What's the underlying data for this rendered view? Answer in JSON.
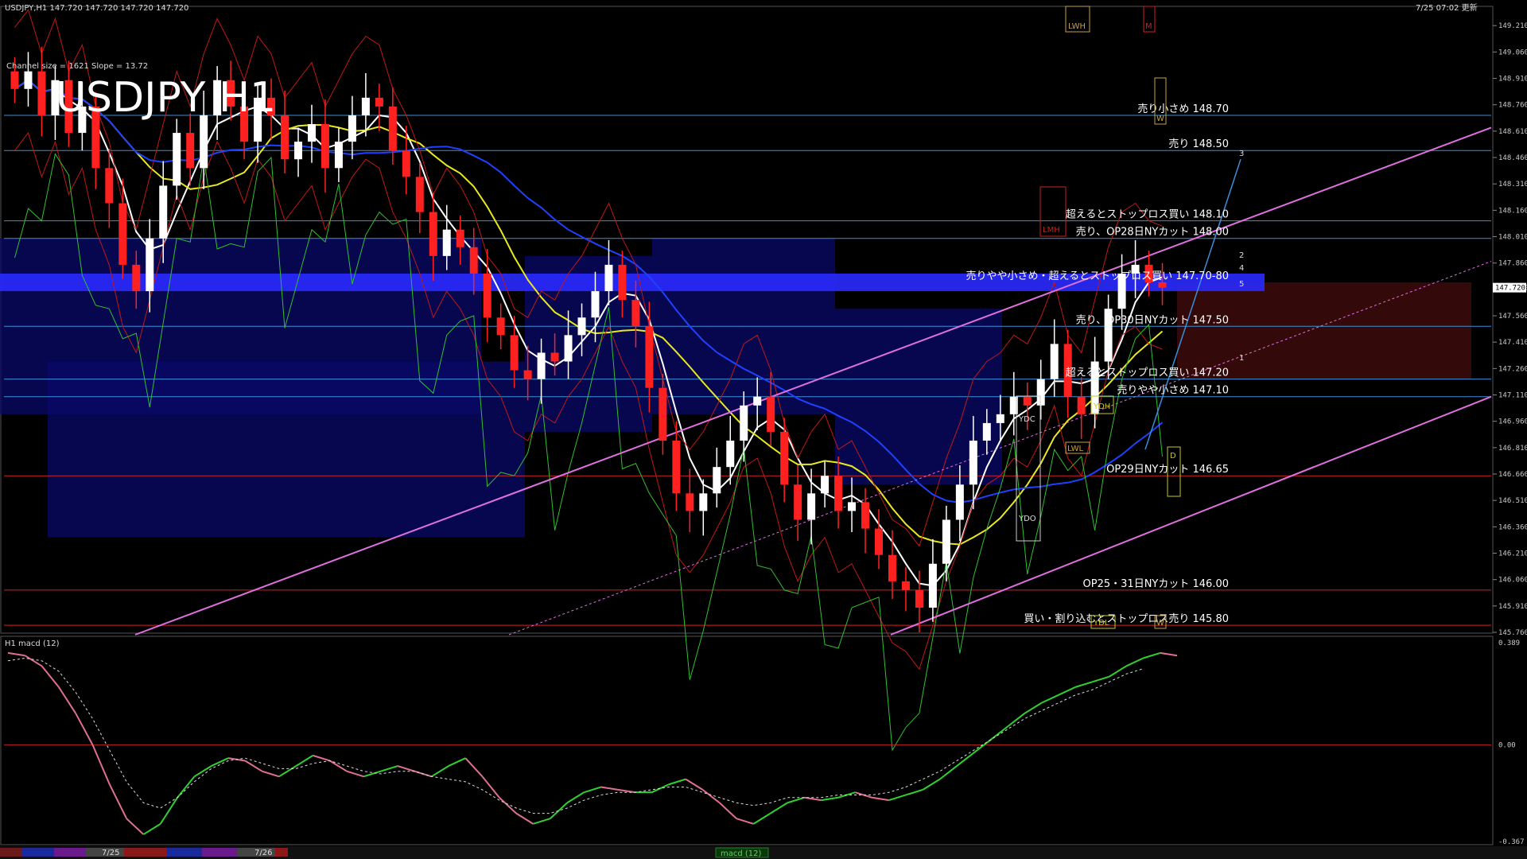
{
  "header": {
    "symbol_line": "USDJPY,H1  147.720 147.720 147.720 147.720",
    "timestamp": "7/25 07:02 更新",
    "channel_info": "Channel size = 1621 Slope = 13.72",
    "big_title": "USDJPY H1"
  },
  "chart_data": {
    "type": "candlestick",
    "price_axis": {
      "ylim": [
        145.76,
        149.22
      ],
      "ticks": [
        "149.210",
        "149.060",
        "148.910",
        "148.760",
        "148.610",
        "148.460",
        "148.310",
        "148.160",
        "148.010",
        "147.860",
        "147.720",
        "147.560",
        "147.410",
        "147.260",
        "147.110",
        "146.960",
        "146.810",
        "146.660",
        "146.510",
        "146.360",
        "146.210",
        "146.060",
        "145.910",
        "145.760"
      ],
      "current_price": "147.720",
      "current_price_value": 147.72
    },
    "levels": [
      {
        "label": "売り小さめ 148.70",
        "price": 148.7,
        "color": "#3a8fd8"
      },
      {
        "label": "売り 148.50",
        "price": 148.5,
        "color": "#3a8fd8"
      },
      {
        "label": "超えるとストップロス買い 148.10",
        "price": 148.1,
        "color": "#3a8fd8"
      },
      {
        "label": "売り、OP28日NYカット 148.00",
        "price": 148.0,
        "color": "#3a8fd8"
      },
      {
        "label": "売りやや小さめ・超えるとストップロス買い 147.70-80",
        "price": 147.75,
        "color": "#2a2aff",
        "band": true
      },
      {
        "label": "売り、OP30日NYカット 147.50",
        "price": 147.5,
        "color": "#3a8fd8"
      },
      {
        "label": "超えるとストップロス買い 147.20",
        "price": 147.2,
        "color": "#3a8fd8"
      },
      {
        "label": "売りやや小さめ 147.10",
        "price": 147.1,
        "color": "#3a8fd8"
      },
      {
        "label": "OP29日NYカット 146.65",
        "price": 146.65,
        "color": "#d02020"
      },
      {
        "label": "OP25・31日NYカット 146.00",
        "price": 146.0,
        "color": "#d02020"
      },
      {
        "label": "買い・割り込むとストップロス売り 145.80",
        "price": 145.8,
        "color": "#d02020"
      }
    ],
    "box_labels": [
      "LWH",
      "M",
      "W",
      "LMH",
      "YDC",
      "YDH",
      "LWL",
      "D",
      "YDO",
      "YDL",
      "W"
    ],
    "wave_labels": [
      "3",
      "2",
      "4",
      "5",
      "1"
    ],
    "close_series": [
      148.85,
      148.95,
      148.7,
      148.9,
      148.6,
      148.75,
      148.4,
      148.2,
      147.85,
      147.7,
      148.0,
      148.3,
      148.6,
      148.4,
      148.7,
      148.9,
      148.75,
      148.55,
      148.8,
      148.7,
      148.45,
      148.55,
      148.65,
      148.4,
      148.55,
      148.7,
      148.8,
      148.75,
      148.5,
      148.35,
      148.15,
      147.9,
      148.05,
      147.95,
      147.8,
      147.55,
      147.45,
      147.25,
      147.2,
      147.35,
      147.3,
      147.45,
      147.55,
      147.7,
      147.85,
      147.65,
      147.5,
      147.15,
      146.85,
      146.55,
      146.45,
      146.55,
      146.7,
      146.85,
      147.05,
      147.1,
      146.9,
      146.6,
      146.4,
      146.55,
      146.65,
      146.45,
      146.5,
      146.35,
      146.2,
      146.05,
      146.0,
      145.9,
      146.15,
      146.4,
      146.6,
      146.85,
      146.95,
      147.0,
      147.1,
      147.05,
      147.2,
      147.4,
      147.1,
      147.0,
      147.3,
      147.6,
      147.8,
      147.85,
      147.75,
      147.72
    ],
    "macd": {
      "label": "H1 macd (12)",
      "ylim": [
        -0.367,
        0.389
      ],
      "ticks": [
        "0.389",
        "0.00",
        "-0.367"
      ],
      "line": [
        0.35,
        0.34,
        0.3,
        0.22,
        0.12,
        0.0,
        -0.15,
        -0.28,
        -0.34,
        -0.3,
        -0.2,
        -0.12,
        -0.08,
        -0.05,
        -0.06,
        -0.1,
        -0.12,
        -0.08,
        -0.04,
        -0.06,
        -0.1,
        -0.12,
        -0.1,
        -0.08,
        -0.1,
        -0.12,
        -0.08,
        -0.05,
        -0.12,
        -0.2,
        -0.26,
        -0.3,
        -0.28,
        -0.22,
        -0.18,
        -0.16,
        -0.17,
        -0.18,
        -0.18,
        -0.15,
        -0.13,
        -0.17,
        -0.22,
        -0.28,
        -0.3,
        -0.26,
        -0.22,
        -0.2,
        -0.21,
        -0.2,
        -0.18,
        -0.2,
        -0.21,
        -0.19,
        -0.17,
        -0.13,
        -0.08,
        -0.03,
        0.02,
        0.07,
        0.12,
        0.16,
        0.19,
        0.22,
        0.24,
        0.26,
        0.3,
        0.33,
        0.35,
        0.34
      ],
      "signal": [
        0.32,
        0.33,
        0.32,
        0.28,
        0.2,
        0.1,
        -0.02,
        -0.14,
        -0.22,
        -0.24,
        -0.2,
        -0.14,
        -0.09,
        -0.06,
        -0.05,
        -0.07,
        -0.09,
        -0.09,
        -0.07,
        -0.06,
        -0.08,
        -0.1,
        -0.11,
        -0.1,
        -0.1,
        -0.12,
        -0.13,
        -0.14,
        -0.17,
        -0.21,
        -0.24,
        -0.26,
        -0.26,
        -0.24,
        -0.21,
        -0.19,
        -0.18,
        -0.18,
        -0.17,
        -0.16,
        -0.16,
        -0.18,
        -0.2,
        -0.22,
        -0.23,
        -0.22,
        -0.2,
        -0.2,
        -0.2,
        -0.19,
        -0.19,
        -0.19,
        -0.18,
        -0.16,
        -0.13,
        -0.1,
        -0.06,
        -0.02,
        0.02,
        0.06,
        0.1,
        0.13,
        0.16,
        0.19,
        0.21,
        0.24,
        0.27,
        0.29
      ]
    }
  },
  "footer": {
    "date_labels": [
      "7/25",
      "7/26"
    ],
    "tab_label": "macd (12)"
  },
  "colors": {
    "bull": "#ffffff",
    "bear": "#ff2020",
    "ma_white": "#ffffff",
    "ma_yellow": "#e8e820",
    "ma_blue": "#2040ff",
    "ribbon_green": "#30c030",
    "channel_pink": "#e070e0",
    "bollinger": "#c01818",
    "level_blue": "#3a8fd8",
    "level_red": "#d02020"
  }
}
